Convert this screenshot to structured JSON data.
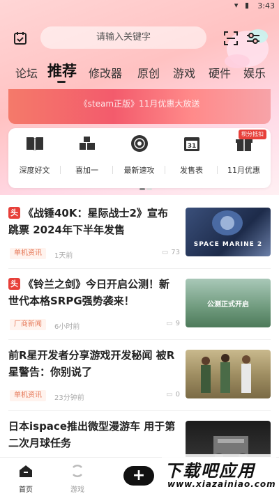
{
  "status_bar": {
    "time": "3:43",
    "icons": [
      "wifi-icon",
      "battery-icon"
    ]
  },
  "search": {
    "placeholder": "请输入关键字"
  },
  "tabs": [
    {
      "label": "论坛",
      "active": false
    },
    {
      "label": "推荐",
      "active": true
    },
    {
      "label": "修改器",
      "active": false
    },
    {
      "label": "原创",
      "active": false
    },
    {
      "label": "游戏",
      "active": false
    },
    {
      "label": "硬件",
      "active": false
    },
    {
      "label": "娱乐",
      "active": false
    }
  ],
  "banner": {
    "text": "《steam正版》11月优惠大放送"
  },
  "quick_actions": [
    {
      "label": "深度好文",
      "icon": "book-icon"
    },
    {
      "label": "喜加一",
      "icon": "blocks-icon"
    },
    {
      "label": "最新速攻",
      "icon": "disc-icon"
    },
    {
      "label": "发售表",
      "icon": "calendar-icon"
    },
    {
      "label": "11月优惠",
      "icon": "gift-icon",
      "badge": "积分抵扣"
    }
  ],
  "news": [
    {
      "tag": "头",
      "title": "《战锤40K：星际战士2》宣布跳票 2024年下半年发售",
      "category": "单机资讯",
      "time": "1天前",
      "comments": "73",
      "thumb_text": "SPACE MARINE 2"
    },
    {
      "tag": "头",
      "title": "《铃兰之剑》今日开启公测！新世代本格SRPG强势袭来！",
      "category": "厂商新闻",
      "time": "6小时前",
      "comments": "9",
      "thumb_text": "公测正式开启"
    },
    {
      "tag": "",
      "title": "前R星开发者分享游戏开发秘闻 被R星警告：你别说了",
      "category": "单机资讯",
      "time": "23分钟前",
      "comments": "0",
      "thumb_text": ""
    },
    {
      "tag": "",
      "title": "日本ispace推出微型漫游车 用于第二次月球任务",
      "category": "",
      "time": "",
      "comments": "",
      "thumb_text": ""
    }
  ],
  "bottom_nav": [
    {
      "label": "首页",
      "icon": "home-icon"
    },
    {
      "label": "游戏",
      "icon": "games-icon"
    }
  ],
  "watermark": {
    "line1": "下载吧应用",
    "line2": "www.xiazainiao.com"
  },
  "colors": {
    "accent": "#e7403a",
    "hero_bg": "#ffc2c2",
    "dark": "#111111"
  }
}
